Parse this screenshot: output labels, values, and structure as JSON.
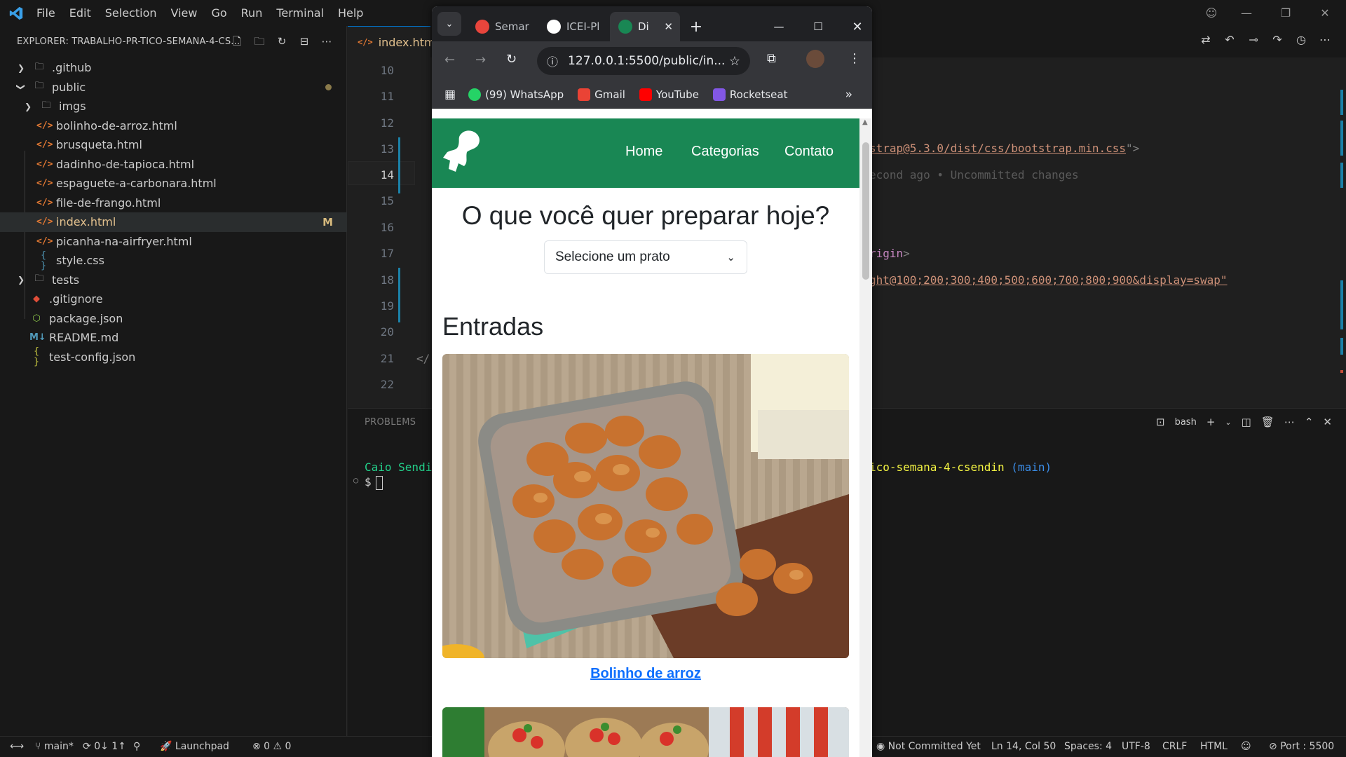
{
  "titlebar": {
    "menu": [
      "File",
      "Edit",
      "Selection",
      "View",
      "Go",
      "Run",
      "Terminal",
      "Help"
    ]
  },
  "sidebar": {
    "title": "EXPLORER: TRABALHO-PR-TICO-SEMANA-4-CS...",
    "items": [
      {
        "label": ".github",
        "kind": "folder",
        "depth": 0,
        "open": false
      },
      {
        "label": "public",
        "kind": "folder",
        "depth": 0,
        "open": true
      },
      {
        "label": "imgs",
        "kind": "folder",
        "depth": 1,
        "open": false
      },
      {
        "label": "bolinho-de-arroz.html",
        "kind": "html",
        "depth": 1
      },
      {
        "label": "brusqueta.html",
        "kind": "html",
        "depth": 1
      },
      {
        "label": "dadinho-de-tapioca.html",
        "kind": "html",
        "depth": 1
      },
      {
        "label": "espaguete-a-carbonara.html",
        "kind": "html",
        "depth": 1
      },
      {
        "label": "file-de-frango.html",
        "kind": "html",
        "depth": 1
      },
      {
        "label": "index.html",
        "kind": "html",
        "depth": 1,
        "badge": "M"
      },
      {
        "label": "picanha-na-airfryer.html",
        "kind": "html",
        "depth": 1
      },
      {
        "label": "style.css",
        "kind": "css",
        "depth": 1
      },
      {
        "label": "tests",
        "kind": "folder",
        "depth": 0,
        "open": false
      },
      {
        "label": ".gitignore",
        "kind": "git",
        "depth": 0
      },
      {
        "label": "package.json",
        "kind": "pkg",
        "depth": 0
      },
      {
        "label": "README.md",
        "kind": "md",
        "depth": 0
      },
      {
        "label": "test-config.json",
        "kind": "json",
        "depth": 0
      }
    ]
  },
  "editor": {
    "tab": "index.html",
    "line_numbers": [
      "10",
      "11",
      "12",
      "13",
      "14",
      "15",
      "16",
      "17",
      "18",
      "19",
      "20",
      "21",
      "22"
    ],
    "current_line": "14",
    "line13_code": "strap@5.3.0/dist/css/bootstrap.min.css",
    "line13_end": "\">",
    "line14_blame": "econd ago • Uncommitted changes",
    "line17_code": "rigin",
    "line17_end": ">",
    "line18_code": "ght@100;200;300;400;500;600;700;800;900&display=swap\"",
    "line21_code": "</"
  },
  "panel": {
    "tab": "PROBLEMS",
    "terminal_label": "bash",
    "prompt_user": "Caio Sendin",
    "prompt_path": "ico-semana-4-csendin",
    "prompt_branch": "(main)",
    "prompt_symbol": "$"
  },
  "statusbar": {
    "branch": "main*",
    "sync": "0↓ 1↑",
    "launchpad": "Launchpad",
    "problems": "⊗ 0 ⚠ 0",
    "blame": "Not Committed Yet",
    "position": "Ln 14, Col 50",
    "spaces": "Spaces: 4",
    "encoding": "UTF-8",
    "eol": "CRLF",
    "language": "HTML",
    "port": "Port : 5500"
  },
  "browser": {
    "tabs": [
      "Semar",
      "ICEI-Pl",
      "Di"
    ],
    "url": "127.0.0.1:5500/public/in...",
    "bookmarks": [
      "(99) WhatsApp",
      "Gmail",
      "YouTube",
      "Rocketseat"
    ],
    "page": {
      "nav": [
        "Home",
        "Categorias",
        "Contato"
      ],
      "heading": "O que você quer preparar hoje?",
      "select_value": "Selecione um prato",
      "section": "Entradas",
      "card_link": "Bolinho de arroz"
    },
    "colors": {
      "navbar": "#198754",
      "link": "#0d6efd"
    }
  }
}
